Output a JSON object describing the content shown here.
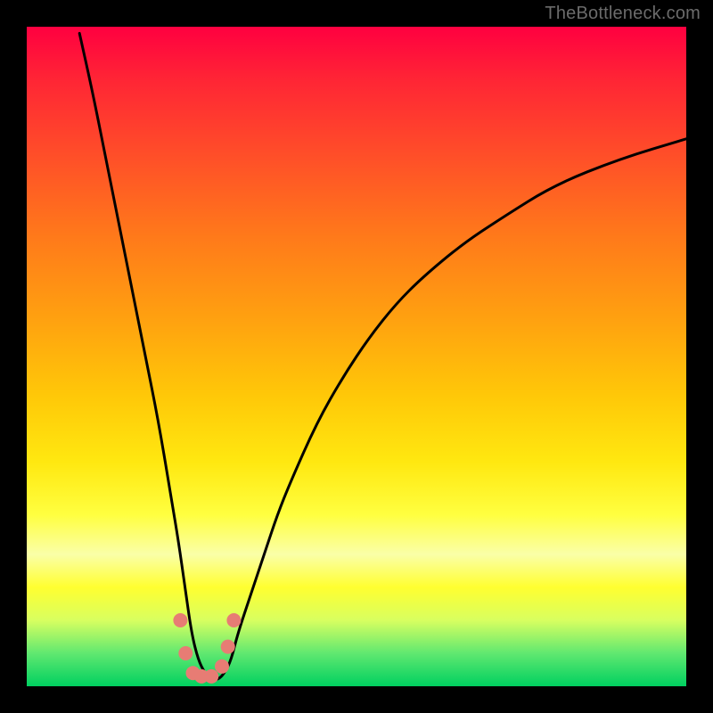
{
  "watermark": "TheBottleneck.com",
  "chart_data": {
    "type": "line",
    "title": "",
    "xlabel": "",
    "ylabel": "",
    "xlim": [
      0,
      100
    ],
    "ylim": [
      0,
      100
    ],
    "curve": {
      "name": "bottleneck-curve",
      "x": [
        8,
        10,
        12,
        14,
        16,
        18,
        20,
        22,
        23,
        24,
        25,
        26,
        27,
        28,
        29,
        30,
        31,
        32,
        34,
        36,
        38,
        40,
        44,
        48,
        52,
        56,
        60,
        66,
        72,
        80,
        90,
        100
      ],
      "y": [
        99,
        90,
        80,
        70,
        60,
        50,
        40,
        28,
        22,
        15,
        8,
        4,
        2,
        1,
        1,
        2,
        4,
        8,
        14,
        20,
        26,
        31,
        40,
        47,
        53,
        58,
        62,
        67,
        71,
        76,
        80,
        83
      ]
    },
    "markers": {
      "name": "highlight-points",
      "color": "#e77c74",
      "points": [
        {
          "x": 23.3,
          "y": 10
        },
        {
          "x": 24.1,
          "y": 5
        },
        {
          "x": 25.2,
          "y": 2
        },
        {
          "x": 26.5,
          "y": 1.5
        },
        {
          "x": 28.0,
          "y": 1.5
        },
        {
          "x": 29.6,
          "y": 3
        },
        {
          "x": 30.5,
          "y": 6
        },
        {
          "x": 31.4,
          "y": 10
        }
      ]
    },
    "gradient_stops": [
      {
        "pos": 0.0,
        "color": "#ff0040"
      },
      {
        "pos": 0.2,
        "color": "#ff5028"
      },
      {
        "pos": 0.44,
        "color": "#ffa010"
      },
      {
        "pos": 0.66,
        "color": "#ffe810"
      },
      {
        "pos": 0.8,
        "color": "#faffa8"
      },
      {
        "pos": 0.9,
        "color": "#d8ff60"
      },
      {
        "pos": 1.0,
        "color": "#00d060"
      }
    ]
  }
}
